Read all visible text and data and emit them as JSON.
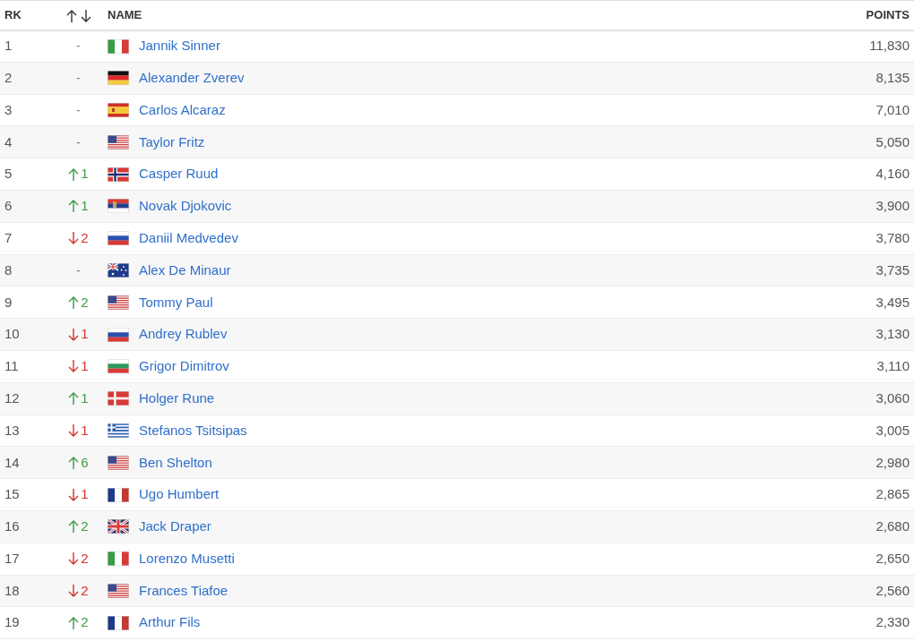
{
  "table": {
    "columns": [
      {
        "label": "RK",
        "kind": "text"
      },
      {
        "kind": "sort-arrows"
      },
      {
        "label": "NAME",
        "kind": "text"
      },
      {
        "label": "POINTS",
        "kind": "text"
      }
    ],
    "rows": [
      {
        "rank": "1",
        "kind": "none",
        "change": "-",
        "flag": {
          "kind": "it"
        },
        "name": "Jannik Sinner",
        "points": "11,830"
      },
      {
        "rank": "2",
        "kind": "none",
        "change": "-",
        "flag": {
          "kind": "de"
        },
        "name": "Alexander Zverev",
        "points": "8,135"
      },
      {
        "rank": "3",
        "kind": "none",
        "change": "-",
        "flag": {
          "kind": "es"
        },
        "name": "Carlos Alcaraz",
        "points": "7,010"
      },
      {
        "rank": "4",
        "kind": "none",
        "change": "-",
        "flag": {
          "kind": "us"
        },
        "name": "Taylor Fritz",
        "points": "5,050"
      },
      {
        "rank": "5",
        "kind": "up",
        "change": "1",
        "flag": {
          "kind": "no"
        },
        "name": "Casper Ruud",
        "points": "4,160"
      },
      {
        "rank": "6",
        "kind": "up",
        "change": "1",
        "flag": {
          "kind": "rs"
        },
        "name": "Novak Djokovic",
        "points": "3,900"
      },
      {
        "rank": "7",
        "kind": "down",
        "change": "2",
        "flag": {
          "kind": "ru"
        },
        "name": "Daniil Medvedev",
        "points": "3,780"
      },
      {
        "rank": "8",
        "kind": "none",
        "change": "-",
        "flag": {
          "kind": "au"
        },
        "name": "Alex De Minaur",
        "points": "3,735"
      },
      {
        "rank": "9",
        "kind": "up",
        "change": "2",
        "flag": {
          "kind": "us"
        },
        "name": "Tommy Paul",
        "points": "3,495"
      },
      {
        "rank": "10",
        "kind": "down",
        "change": "1",
        "flag": {
          "kind": "ru"
        },
        "name": "Andrey Rublev",
        "points": "3,130"
      },
      {
        "rank": "11",
        "kind": "down",
        "change": "1",
        "flag": {
          "kind": "bg"
        },
        "name": "Grigor Dimitrov",
        "points": "3,110"
      },
      {
        "rank": "12",
        "kind": "up",
        "change": "1",
        "flag": {
          "kind": "dk"
        },
        "name": "Holger Rune",
        "points": "3,060"
      },
      {
        "rank": "13",
        "kind": "down",
        "change": "1",
        "flag": {
          "kind": "gr"
        },
        "name": "Stefanos Tsitsipas",
        "points": "3,005"
      },
      {
        "rank": "14",
        "kind": "up",
        "change": "6",
        "flag": {
          "kind": "us"
        },
        "name": "Ben Shelton",
        "points": "2,980"
      },
      {
        "rank": "15",
        "kind": "down",
        "change": "1",
        "flag": {
          "kind": "fr"
        },
        "name": "Ugo Humbert",
        "points": "2,865"
      },
      {
        "rank": "16",
        "kind": "up",
        "change": "2",
        "flag": {
          "kind": "gb"
        },
        "name": "Jack Draper",
        "points": "2,680"
      },
      {
        "rank": "17",
        "kind": "down",
        "change": "2",
        "flag": {
          "kind": "it"
        },
        "name": "Lorenzo Musetti",
        "points": "2,650"
      },
      {
        "rank": "18",
        "kind": "down",
        "change": "2",
        "flag": {
          "kind": "us"
        },
        "name": "Frances Tiafoe",
        "points": "2,560"
      },
      {
        "rank": "19",
        "kind": "up",
        "change": "2",
        "flag": {
          "kind": "fr"
        },
        "name": "Arthur Fils",
        "points": "2,330"
      }
    ]
  }
}
